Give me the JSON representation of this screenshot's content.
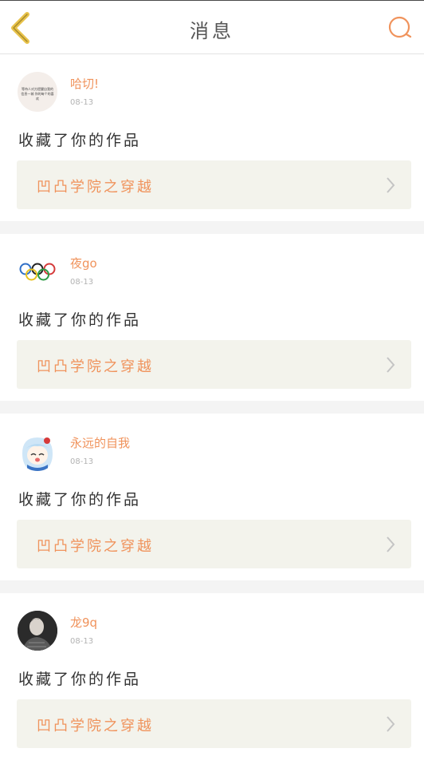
{
  "header": {
    "title": "消息",
    "back_icon": "chevron-left-icon",
    "search_icon": "search-icon"
  },
  "colors": {
    "accent": "#f0935c",
    "back_arrow": "#e8c24a",
    "card_bg": "#f3f3ec",
    "separator": "#f4f4f4"
  },
  "notifications": [
    {
      "user": "哈切!",
      "date": "08-13",
      "action": "收藏了你的作品",
      "work_title": "凹凸学院之穿越",
      "avatar_text": "等待人对方提醒自我的信息一城 你的每个的喜欢"
    },
    {
      "user": "夜go",
      "date": "08-13",
      "action": "收藏了你的作品",
      "work_title": "凹凸学院之穿越"
    },
    {
      "user": "永远的自我",
      "date": "08-13",
      "action": "收藏了你的作品",
      "work_title": "凹凸学院之穿越"
    },
    {
      "user": "龙9q",
      "date": "08-13",
      "action": "收藏了你的作品",
      "work_title": "凹凸学院之穿越"
    }
  ]
}
